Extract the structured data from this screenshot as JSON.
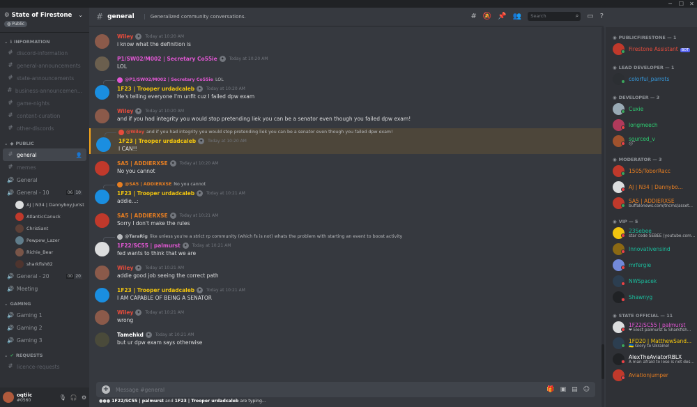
{
  "window": {
    "minimize": "─",
    "maximize": "☐",
    "close": "✕"
  },
  "server": {
    "name": "State of Firestone",
    "badge": "Public",
    "categories": {
      "information": "INFORMATION",
      "public": "PUBLIC",
      "gaming": "GAMING",
      "requests": "REQUESTS"
    },
    "info_channels": [
      "discord-information",
      "general-announcements",
      "state-announcements",
      "business-announcemen...",
      "game-nights",
      "content-curation",
      "other-discords"
    ],
    "public_channels": {
      "general": "general",
      "memes": "memes",
      "voice_general": "General",
      "general10": {
        "label": "General - 10",
        "count_a": "06",
        "count_b": "10"
      },
      "general10_users": [
        "AJ | N34 | Dannyboy.Jurist",
        "AtlanticCanuck",
        "ChrisSant",
        "Pewpew_Lazer",
        "Richie_Bear",
        "sharkfish82"
      ],
      "general20": {
        "label": "General - 20",
        "count_a": "00",
        "count_b": "20"
      },
      "meeting": "Meeting"
    },
    "gaming_channels": [
      "Gaming 1",
      "Gaming 2",
      "Gaming 3"
    ],
    "request_channels": [
      "licence-requests"
    ]
  },
  "user_panel": {
    "name": "oqtiic",
    "tag": "#0560",
    "mic": "🎙",
    "headset": "🎧",
    "settings": "⚙"
  },
  "header": {
    "channel": "general",
    "topic": "Generalized community conversations.",
    "search_placeholder": "Search"
  },
  "messages": [
    {
      "author": "Wiley",
      "color": "#e74c3c",
      "time": "Today at 10:20 AM",
      "text": "i know what the definition is",
      "avatar": "#8b5a4a"
    },
    {
      "author": "P1/SW02/M002 | Secretary Co55ie",
      "color": "#e057d2",
      "time": "Today at 10:20 AM",
      "text": "LOL",
      "avatar": "#6b5f4e"
    },
    {
      "reply_to": "@P1/SW02/M002 | Secretary Co55ie",
      "reply_text": "LOL",
      "reply_color": "#e057d2",
      "author": "1F23 | Trooper urdadcaleb",
      "color": "#f1c40f",
      "time": "Today at 10:20 AM",
      "text": "He's telling everyone I'm unfit cuz I failed dpw exam",
      "avatar": "#1a8ee0"
    },
    {
      "author": "Wiley",
      "color": "#e74c3c",
      "time": "Today at 10:20 AM",
      "text": "and if you had integrity you would stop pretending liek you can be a senator even though you failed dpw exam!",
      "avatar": "#8b5a4a"
    },
    {
      "reply_to": "@Wiley",
      "reply_text": "and if you had integrity you would stop pretending liek you can be a senator even though you failed dpw exam!",
      "reply_color": "#e74c3c",
      "author": "1F23 | Trooper urdadcaleb",
      "color": "#f1c40f",
      "time": "Today at 10:20 AM",
      "text": "I CAN!!",
      "avatar": "#1a8ee0",
      "highlight": true
    },
    {
      "author": "SA5 | ADDIERXSE",
      "color": "#e67e22",
      "time": "Today at 10:20 AM",
      "text": "No you cannot",
      "avatar": "#c0392b"
    },
    {
      "reply_to": "@SA5 | ADDIERXSE",
      "reply_text": "No you cannot",
      "reply_color": "#e67e22",
      "author": "1F23 | Trooper urdadcaleb",
      "color": "#f1c40f",
      "time": "Today at 10:21 AM",
      "text": "addie...:",
      "avatar": "#1a8ee0"
    },
    {
      "author": "SA5 | ADDIERXSE",
      "color": "#e67e22",
      "time": "Today at 10:21 AM",
      "text": "Sorry I don't make the rules",
      "avatar": "#c0392b"
    },
    {
      "reply_to": "@TaraRig",
      "reply_text": "like unless you're a strict rp community (which fs is not) whats the problem with starting an event to boost activity",
      "reply_color": "#b9bbbe",
      "author": "1F22/SC55 | palmurst",
      "color": "#e057d2",
      "time": "Today at 10:21 AM",
      "text": "fed wants to think that we are",
      "avatar": "#dcddde"
    },
    {
      "author": "Wiley",
      "color": "#e74c3c",
      "time": "Today at 10:21 AM",
      "text": "addie good job seeing the correct path",
      "avatar": "#8b5a4a"
    },
    {
      "author": "1F23 | Trooper urdadcaleb",
      "color": "#f1c40f",
      "time": "Today at 10:21 AM",
      "text": "I AM CAPABLE OF BEING A SENATOR",
      "avatar": "#1a8ee0"
    },
    {
      "author": "Wiley",
      "color": "#e74c3c",
      "time": "Today at 10:21 AM",
      "text": "wrong",
      "avatar": "#8b5a4a"
    },
    {
      "author": "Tamehkd",
      "color": "#ffffff",
      "time": "Today at 10:21 AM",
      "text": "but ur dpw exam says otherwise",
      "avatar": "#4a4a3a"
    }
  ],
  "composer": {
    "placeholder": "Message #general"
  },
  "typing": {
    "prefix": "●●●",
    "user_a": "1F22/SC55 | palmurst",
    "and": "and",
    "user_b": "1F23 | Trooper urdadcaleb",
    "suffix": "are typing..."
  },
  "members": {
    "groups": [
      {
        "title": "PUBLICFIRESTONE — 1",
        "list": [
          {
            "name": "Firestone Assistant",
            "color": "#e74c3c",
            "badge": "BOT",
            "av": "#c0392b",
            "dot": "#3ba55c"
          }
        ]
      },
      {
        "title": "LEAD DEVELOPER — 1",
        "list": [
          {
            "name": "colorful_parrots",
            "color": "#3498db",
            "av": "#2c2f33",
            "dot": "#3ba55c"
          }
        ]
      },
      {
        "title": "DEVELOPER — 3",
        "list": [
          {
            "name": "Cuxie",
            "color": "#2ecc71",
            "av": "#99aab5",
            "dot": "#3ba55c"
          },
          {
            "name": "longmeech",
            "color": "#2ecc71",
            "av": "#b03a5b",
            "dot": "#ed4245"
          },
          {
            "name": "sourced_v",
            "color": "#2ecc71",
            "status": "😴",
            "av": "#a0522d",
            "dot": "#ed4245"
          }
        ]
      },
      {
        "title": "MODERATOR — 3",
        "list": [
          {
            "name": "1505/ToborRacc",
            "color": "#e67e22",
            "av": "#c0392b",
            "dot": "#3ba55c"
          },
          {
            "name": "AJ | N34 | Dannybo...",
            "color": "#e67e22",
            "av": "#dcddde",
            "dot": "#ed4245"
          },
          {
            "name": "SA5 | ADDIERXSE",
            "color": "#e67e22",
            "status": "buffalonews.com/tncms/asset...",
            "av": "#c0392b",
            "dot": "#3ba55c"
          }
        ]
      },
      {
        "title": "VIP — 5",
        "list": [
          {
            "name": "23Sebee",
            "color": "#1abc9c",
            "status": "star code SEBEE (youtube.com...",
            "av": "#f1c40f",
            "dot": "#ed4245"
          },
          {
            "name": "Innovativensind",
            "color": "#1abc9c",
            "av": "#8b6914",
            "dot": "#ed4245"
          },
          {
            "name": "mrfergie",
            "color": "#1abc9c",
            "av": "#7289da",
            "dot": "#ed4245"
          },
          {
            "name": "NWSpacek",
            "color": "#1abc9c",
            "av": "#2c3e50",
            "dot": "#ed4245"
          },
          {
            "name": "Shawnyg",
            "color": "#1abc9c",
            "av": "#202225",
            "dot": "#ed4245"
          }
        ]
      },
      {
        "title": "STATE OFFICIAL — 11",
        "list": [
          {
            "name": "1F22/SC55 | palmurst",
            "color": "#e057d2",
            "status": "❤ Elect palmurst & Sharkfish...",
            "av": "#dcddde",
            "dot": "#ed4245"
          },
          {
            "name": "1FD20 | MatthewSand...",
            "color": "#f1c40f",
            "status": "🇺🇦 Glory to Ukraine!",
            "av": "#2c3e50",
            "dot": "#3ba55c"
          },
          {
            "name": "AlexTheAviatorRBLX",
            "color": "#ffffff",
            "status": "A man afraid to lose is not des...",
            "av": "#202225",
            "dot": "#ed4245"
          },
          {
            "name": "Aviationjumper",
            "color": "#e67e22",
            "av": "#c0392b",
            "dot": "#ed4245"
          }
        ]
      }
    ]
  },
  "colors": {
    "accent": "#5865f2",
    "highlight": "#faa81a",
    "online": "#3ba55c",
    "dnd": "#ed4245"
  }
}
